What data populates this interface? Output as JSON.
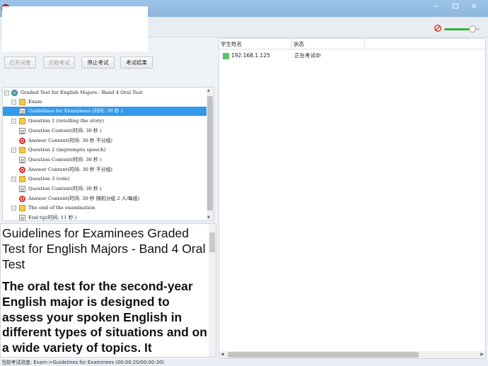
{
  "window": {
    "title": "",
    "minimize": "−",
    "close": "✕"
  },
  "toolbar": {
    "open_label": "打开试卷",
    "start_label": "开始考试",
    "stop_label": "停止考试",
    "result_label": "考试结果",
    "volume_level": 0.8
  },
  "tree": {
    "root": "Graded Test for English Majors - Band 4  Oral Test",
    "items": [
      {
        "label": "Exam"
      },
      {
        "label": "Guidelines for Examinees (时间: 30 秒 )"
      },
      {
        "label": "Question 1 (retelling the story)"
      },
      {
        "label": "Question Content(时间: 30 秒 )"
      },
      {
        "label": "Answer Content(时间: 30 秒  不分组)"
      },
      {
        "label": "Question 2 (impromptu speech)"
      },
      {
        "label": "Question Content(时间: 30 秒 )"
      },
      {
        "label": "Answer Content(时间: 30 秒  不分组)"
      },
      {
        "label": "Question 3 (role)"
      },
      {
        "label": "Question Content(时间: 30 秒 )"
      },
      {
        "label": "Answer Content(时间: 30 秒 随机分组 2 人/每组)"
      },
      {
        "label": "The end of the examination"
      },
      {
        "label": "End tip(时间: 11 秒 )"
      }
    ]
  },
  "preview": {
    "title": "Guidelines for Examinees Graded Test for English Majors - Band 4  Oral Test",
    "body": "The oral test for the second-year English major is designed to assess your spoken English in different types of situations and on a wide variety of topics.  It"
  },
  "student_list": {
    "columns": [
      "学生姓名",
      "状态",
      ""
    ],
    "rows": [
      {
        "ip": "192.168.1.125",
        "status": "正在考试中",
        "status_color": "#63c06b"
      }
    ]
  },
  "statusbar": {
    "text": "当前考试进度: Exam->Guidelines for Examinees (00:00:20/00:00:30)"
  }
}
